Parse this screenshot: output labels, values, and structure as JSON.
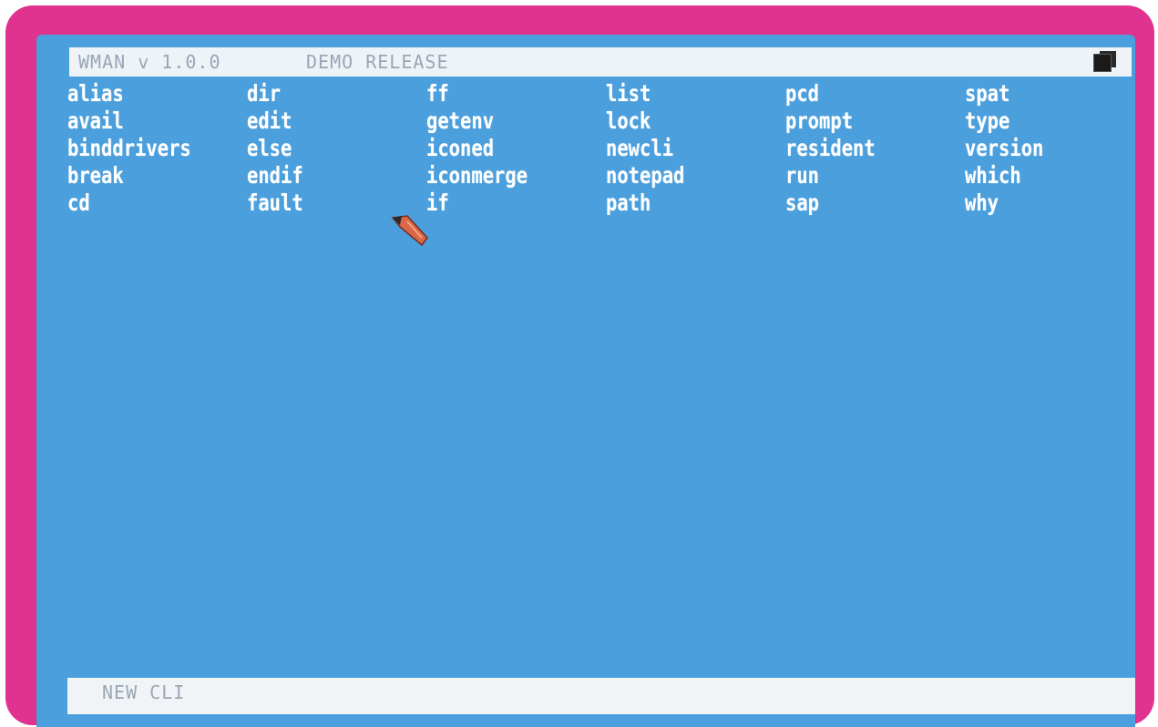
{
  "window": {
    "title": "WMAN v 1.0.0",
    "subtitle": "DEMO RELEASE"
  },
  "listing": [
    "alias",
    "avail",
    "binddrivers",
    "break",
    "cd",
    "dir",
    "edit",
    "else",
    "endif",
    "fault",
    "ff",
    "getenv",
    "iconed",
    "iconmerge",
    "if",
    "list",
    "lock",
    "newcli",
    "notepad",
    "path",
    "pcd",
    "prompt",
    "resident",
    "run",
    "sap",
    "spat",
    "type",
    "version",
    "which",
    "why"
  ],
  "status": {
    "text": "NEW CLI"
  },
  "icons": {
    "pointer": "mouse-pointer-icon",
    "depth": "depth-gadget-icon"
  },
  "colors": {
    "bezel": "#e0328f",
    "screen": "#4b9fdc",
    "bar": "#eef3f8",
    "text": "#ffffff"
  }
}
